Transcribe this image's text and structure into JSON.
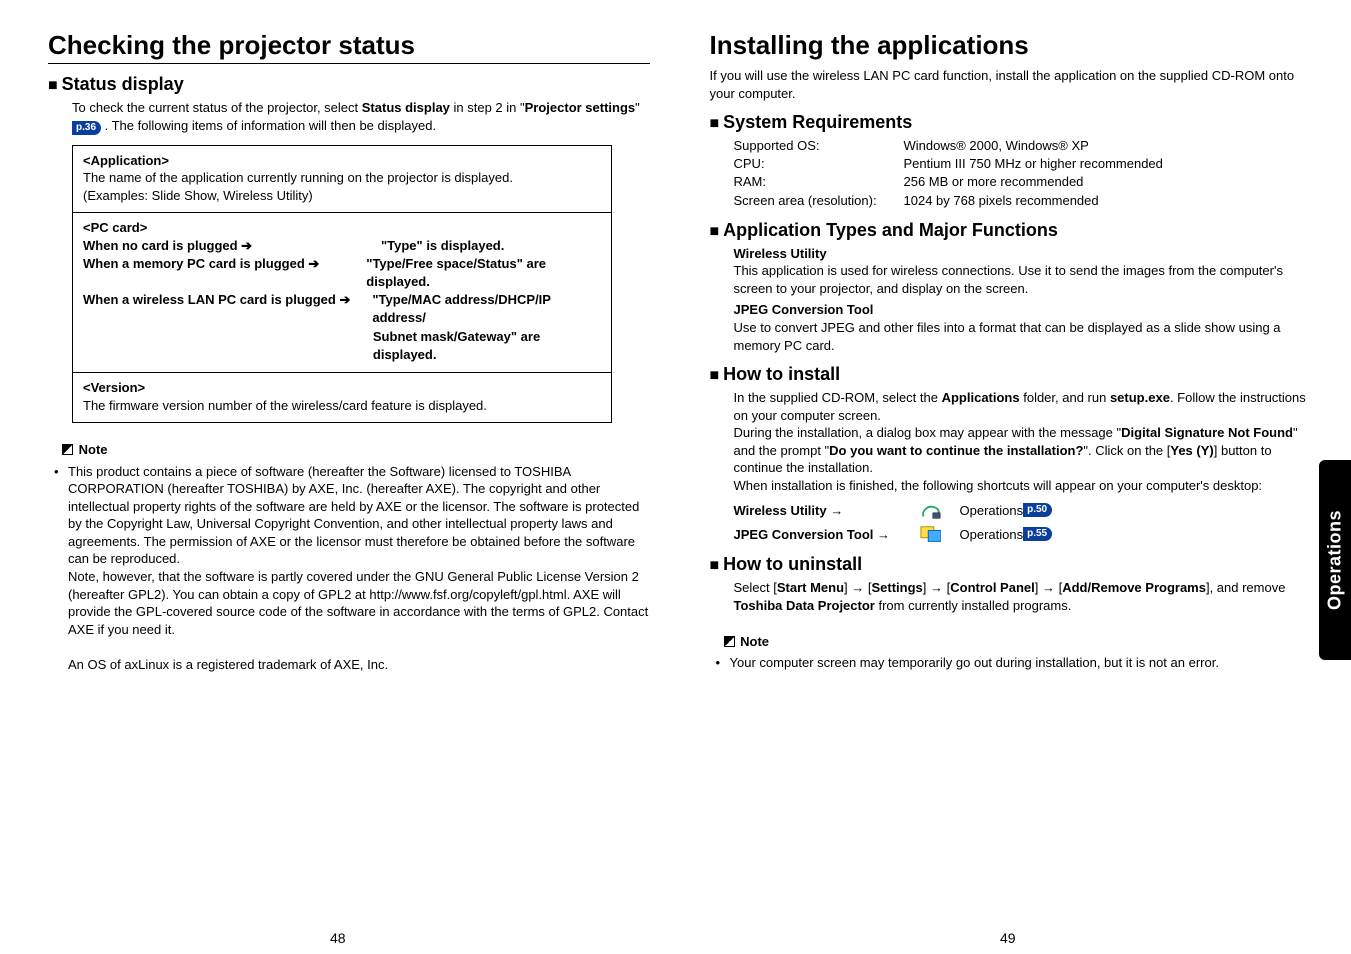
{
  "left": {
    "title": "Checking the projector status",
    "status_display": {
      "heading": "Status display",
      "intro_a": "To check the current status of the projector, select ",
      "intro_b": "Status display",
      "intro_c": " in step 2 in \"",
      "intro_d": "Projector settings",
      "intro_e": "\" ",
      "pref": "p.36",
      "intro_f": " . The following items of information will then be displayed."
    },
    "box": {
      "application": {
        "title": "<Application>",
        "line1": "The name of the application currently running on the projector is displayed.",
        "line2": "(Examples: Slide Show, Wireless Utility)"
      },
      "pccard": {
        "title": "<PC card>",
        "r1l": "When no card is plugged ➔",
        "r1r": "\"Type\" is displayed.",
        "r2l": "When a memory PC card is plugged ➔",
        "r2r": "\"Type/Free space/Status\" are displayed.",
        "r3l": "When a wireless LAN PC card is plugged ➔",
        "r3r": "\"Type/MAC address/DHCP/IP address/",
        "r4r": "Subnet mask/Gateway\" are displayed."
      },
      "version": {
        "title": "<Version>",
        "line": "The firmware version number of the wireless/card feature is displayed."
      }
    },
    "note_label": "Note",
    "note_body_1": "This product contains a piece of software (hereafter the Software) licensed to TOSHIBA CORPORATION (hereafter TOSHIBA) by AXE, Inc. (hereafter AXE). The copyright and other intellectual property rights of the software are held by AXE or the licensor. The software is protected by the Copyright Law, Universal Copyright Convention, and other intellectual property laws and agreements. The permission of AXE or the licensor must therefore be obtained before the software can be reproduced.",
    "note_body_2": "Note, however, that the software is partly covered under the GNU General Public License Version 2 (hereafter GPL2). You can obtain a copy of GPL2 at http://www.fsf.org/copyleft/gpl.html. AXE will provide the GPL-covered source code of the software in accordance with the terms of GPL2. Contact AXE if you need it.",
    "note_body_3": "An OS of axLinux is a registered trademark of AXE, Inc.",
    "page": "48"
  },
  "right": {
    "title": "Installing the applications",
    "intro": "If you will use the wireless LAN PC card function, install the application on the supplied CD-ROM onto your computer.",
    "sysreq": {
      "heading": "System Requirements",
      "os_l": "Supported OS:",
      "os_v": "Windows® 2000, Windows® XP",
      "cpu_l": "CPU:",
      "cpu_v": "Pentium III 750 MHz or higher recommended",
      "ram_l": "RAM:",
      "ram_v": "256 MB or more recommended",
      "res_l": "Screen area (resolution):",
      "res_v": "1024 by 768 pixels recommended"
    },
    "apps": {
      "heading": "Application Types and Major Functions",
      "wu_t": "Wireless Utility",
      "wu_b": "This application is used for wireless connections. Use it to send the images from the computer's screen to your projector, and display on the screen.",
      "jt_t": "JPEG Conversion Tool",
      "jt_b": "Use to convert JPEG and other files into a format that can be displayed as a slide show using a memory PC card."
    },
    "install": {
      "heading": "How to install",
      "p1a": "In the supplied CD-ROM, select the ",
      "p1b": "Applications",
      "p1c": " folder, and run ",
      "p1d": "setup.exe",
      "p1e": ". Follow the instructions on your computer screen.",
      "p2a": "During the installation, a dialog box may appear with the message \"",
      "p2b": "Digital Signature Not Found",
      "p2c": "\" and the prompt \"",
      "p2d": "Do you want to continue the installation?",
      "p2e": "\". Click on the [",
      "p2f": "Yes (Y)",
      "p2g": "] button to continue the installation.",
      "p3": "When installation is finished, the following shortcuts will appear on your computer's desktop:",
      "sc1": "Wireless Utility →",
      "sc1_op": "Operations ",
      "sc1_p": "p.50",
      "sc2": "JPEG Conversion Tool →",
      "sc2_op": "Operations ",
      "sc2_p": "p.55"
    },
    "uninstall": {
      "heading": "How to uninstall",
      "a": "Select [",
      "b": "Start Menu",
      "c": "] → [",
      "d": "Settings",
      "e": "] → [",
      "f": "Control Panel",
      "g": "] → [",
      "h": "Add/Remove Programs",
      "i": "], and remove ",
      "j": "Toshiba Data Projector",
      "k": " from currently installed programs."
    },
    "note_label": "Note",
    "note_body": "Your computer screen may temporarily go out during installation, but it is not an error.",
    "side_tab": "Operations",
    "page": "49"
  }
}
